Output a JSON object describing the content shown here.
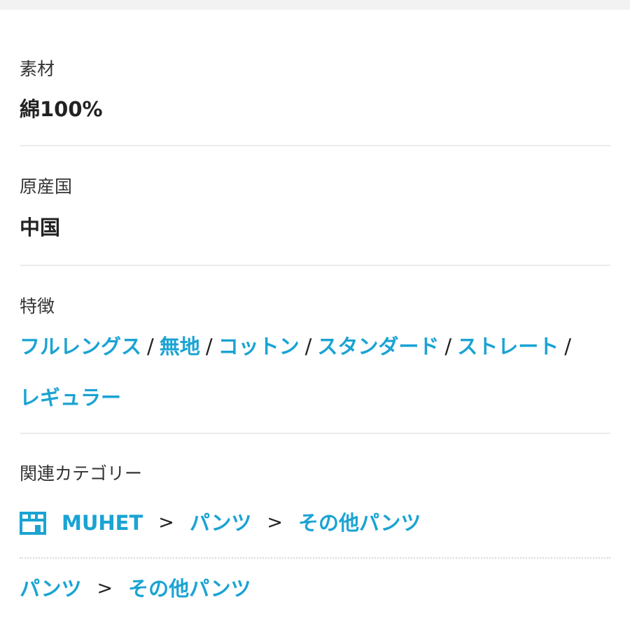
{
  "material": {
    "label": "素材",
    "value": "綿100%"
  },
  "origin": {
    "label": "原産国",
    "value": "中国"
  },
  "features": {
    "label": "特徴",
    "separator": "/",
    "items": [
      "フルレングス",
      "無地",
      "コットン",
      "スタンダード",
      "ストレート",
      "レギュラー"
    ]
  },
  "related": {
    "label": "関連カテゴリー",
    "arrow": ">",
    "primary_path": {
      "icon": "shop-icon",
      "items": [
        "MUHET",
        "パンツ",
        "その他パンツ"
      ]
    },
    "secondary_path": {
      "items": [
        "パンツ",
        "その他パンツ"
      ]
    }
  },
  "colors": {
    "link": "#1aa3d3",
    "text": "#222222"
  }
}
